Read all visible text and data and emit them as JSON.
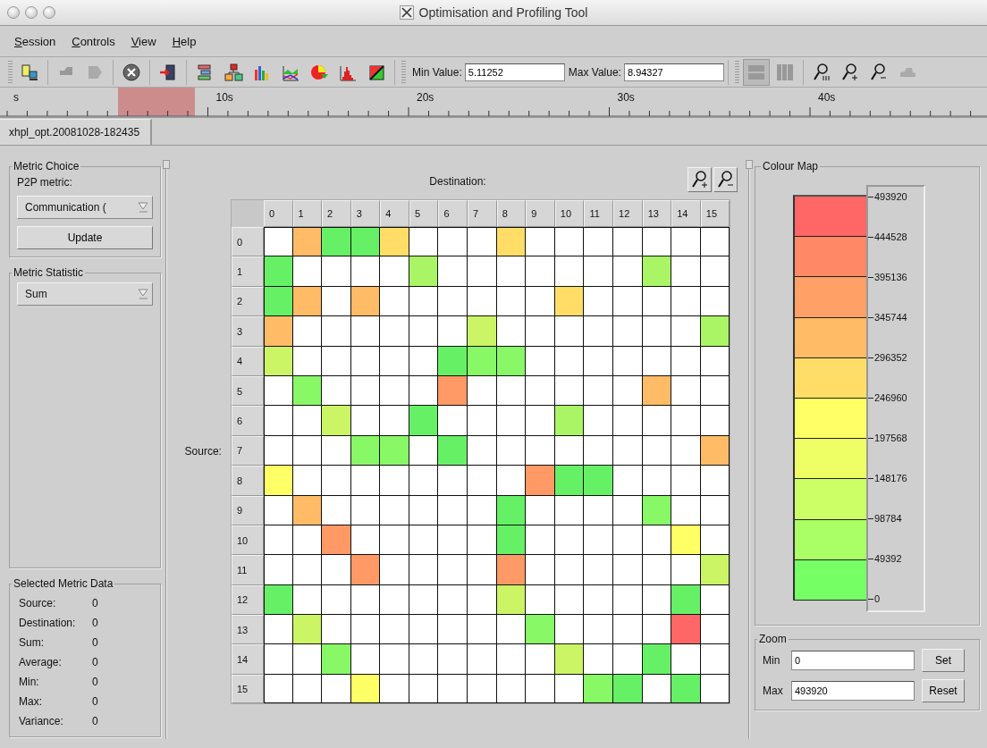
{
  "window": {
    "title": "Optimisation and Profiling Tool"
  },
  "menu": [
    {
      "label": "Session"
    },
    {
      "label": "Controls"
    },
    {
      "label": "View"
    },
    {
      "label": "Help"
    }
  ],
  "toolbar": {
    "min_label": "Min Value:",
    "min_value": "5.11252",
    "max_label": "Max Value:",
    "max_value": "8.94327"
  },
  "timeline": {
    "labels": [
      "s",
      "10s",
      "20s",
      "30s",
      "40s"
    ]
  },
  "tabs": [
    {
      "label": "xhpl_opt.20081028-182435",
      "selected": true
    }
  ],
  "metric_choice": {
    "title": "Metric Choice",
    "label": "P2P metric:",
    "value": "Communication (",
    "button": "Update"
  },
  "metric_statistic": {
    "title": "Metric Statistic",
    "value": "Sum"
  },
  "selected_metric_data": {
    "title": "Selected Metric Data",
    "rows": [
      {
        "label": "Source:",
        "value": "0"
      },
      {
        "label": "Destination:",
        "value": "0"
      },
      {
        "label": "Sum:",
        "value": "0"
      },
      {
        "label": "Average:",
        "value": "0"
      },
      {
        "label": "Min:",
        "value": "0"
      },
      {
        "label": "Max:",
        "value": "0"
      },
      {
        "label": "Variance:",
        "value": "0"
      }
    ]
  },
  "matrix": {
    "x_title": "Destination:",
    "y_title": "Source:",
    "columns": [
      "0",
      "1",
      "2",
      "3",
      "4",
      "5",
      "6",
      "7",
      "8",
      "9",
      "10",
      "11",
      "12",
      "13",
      "14",
      "15"
    ],
    "rows": [
      {
        "label": "0",
        "cells": [
          {
            "color": "#ffffff"
          },
          {
            "color": "#ffbb66"
          },
          {
            "color": "#66f066"
          },
          {
            "color": "#66f066"
          },
          {
            "color": "#ffdd66"
          },
          {
            "color": "#ffffff"
          },
          {
            "color": "#ffffff"
          },
          {
            "color": "#ffffff"
          },
          {
            "color": "#ffdd66"
          },
          {
            "color": "#ffffff"
          },
          {
            "color": "#ffffff"
          },
          {
            "color": "#ffffff"
          },
          {
            "color": "#ffffff"
          },
          {
            "color": "#ffffff"
          },
          {
            "color": "#ffffff"
          },
          {
            "color": "#ffffff"
          }
        ]
      },
      {
        "label": "1",
        "cells": [
          {
            "color": "#66f066"
          },
          {
            "color": "#ffffff"
          },
          {
            "color": "#ffffff"
          },
          {
            "color": "#ffffff"
          },
          {
            "color": "#ffffff"
          },
          {
            "color": "#aaf566"
          },
          {
            "color": "#ffffff"
          },
          {
            "color": "#ffffff"
          },
          {
            "color": "#ffffff"
          },
          {
            "color": "#ffffff"
          },
          {
            "color": "#ffffff"
          },
          {
            "color": "#ffffff"
          },
          {
            "color": "#ffffff"
          },
          {
            "color": "#aaf566"
          },
          {
            "color": "#ffffff"
          },
          {
            "color": "#ffffff"
          }
        ]
      },
      {
        "label": "2",
        "cells": [
          {
            "color": "#66f066"
          },
          {
            "color": "#ffbb66"
          },
          {
            "color": "#ffffff"
          },
          {
            "color": "#ffbb66"
          },
          {
            "color": "#ffffff"
          },
          {
            "color": "#ffffff"
          },
          {
            "color": "#ffffff"
          },
          {
            "color": "#ffffff"
          },
          {
            "color": "#ffffff"
          },
          {
            "color": "#ffffff"
          },
          {
            "color": "#ffdd66"
          },
          {
            "color": "#ffffff"
          },
          {
            "color": "#ffffff"
          },
          {
            "color": "#ffffff"
          },
          {
            "color": "#ffffff"
          },
          {
            "color": "#ffffff"
          }
        ]
      },
      {
        "label": "3",
        "cells": [
          {
            "color": "#ffbb66"
          },
          {
            "color": "#ffffff"
          },
          {
            "color": "#ffffff"
          },
          {
            "color": "#ffffff"
          },
          {
            "color": "#ffffff"
          },
          {
            "color": "#ffffff"
          },
          {
            "color": "#ffffff"
          },
          {
            "color": "#ccf566"
          },
          {
            "color": "#ffffff"
          },
          {
            "color": "#ffffff"
          },
          {
            "color": "#ffffff"
          },
          {
            "color": "#ffffff"
          },
          {
            "color": "#ffffff"
          },
          {
            "color": "#ffffff"
          },
          {
            "color": "#ffffff"
          },
          {
            "color": "#aaf566"
          }
        ]
      },
      {
        "label": "4",
        "cells": [
          {
            "color": "#ccf566"
          },
          {
            "color": "#ffffff"
          },
          {
            "color": "#ffffff"
          },
          {
            "color": "#ffffff"
          },
          {
            "color": "#ffffff"
          },
          {
            "color": "#ffffff"
          },
          {
            "color": "#66f066"
          },
          {
            "color": "#88f866"
          },
          {
            "color": "#88f866"
          },
          {
            "color": "#ffffff"
          },
          {
            "color": "#ffffff"
          },
          {
            "color": "#ffffff"
          },
          {
            "color": "#ffffff"
          },
          {
            "color": "#ffffff"
          },
          {
            "color": "#ffffff"
          },
          {
            "color": "#ffffff"
          }
        ]
      },
      {
        "label": "5",
        "cells": [
          {
            "color": "#ffffff"
          },
          {
            "color": "#88f866"
          },
          {
            "color": "#ffffff"
          },
          {
            "color": "#ffffff"
          },
          {
            "color": "#ffffff"
          },
          {
            "color": "#ffffff"
          },
          {
            "color": "#ff9966"
          },
          {
            "color": "#ffffff"
          },
          {
            "color": "#ffffff"
          },
          {
            "color": "#ffffff"
          },
          {
            "color": "#ffffff"
          },
          {
            "color": "#ffffff"
          },
          {
            "color": "#ffffff"
          },
          {
            "color": "#ffbb66"
          },
          {
            "color": "#ffffff"
          },
          {
            "color": "#ffffff"
          }
        ]
      },
      {
        "label": "6",
        "cells": [
          {
            "color": "#ffffff"
          },
          {
            "color": "#ffffff"
          },
          {
            "color": "#ccf566"
          },
          {
            "color": "#ffffff"
          },
          {
            "color": "#ffffff"
          },
          {
            "color": "#66f066"
          },
          {
            "color": "#ffffff"
          },
          {
            "color": "#ffffff"
          },
          {
            "color": "#ffffff"
          },
          {
            "color": "#ffffff"
          },
          {
            "color": "#aaf566"
          },
          {
            "color": "#ffffff"
          },
          {
            "color": "#ffffff"
          },
          {
            "color": "#ffffff"
          },
          {
            "color": "#ffffff"
          },
          {
            "color": "#ffffff"
          }
        ]
      },
      {
        "label": "7",
        "cells": [
          {
            "color": "#ffffff"
          },
          {
            "color": "#ffffff"
          },
          {
            "color": "#ffffff"
          },
          {
            "color": "#88f866"
          },
          {
            "color": "#88f866"
          },
          {
            "color": "#ffffff"
          },
          {
            "color": "#66f066"
          },
          {
            "color": "#ffffff"
          },
          {
            "color": "#ffffff"
          },
          {
            "color": "#ffffff"
          },
          {
            "color": "#ffffff"
          },
          {
            "color": "#ffffff"
          },
          {
            "color": "#ffffff"
          },
          {
            "color": "#ffffff"
          },
          {
            "color": "#ffffff"
          },
          {
            "color": "#ffbb66"
          }
        ]
      },
      {
        "label": "8",
        "cells": [
          {
            "color": "#ffff66"
          },
          {
            "color": "#ffffff"
          },
          {
            "color": "#ffffff"
          },
          {
            "color": "#ffffff"
          },
          {
            "color": "#ffffff"
          },
          {
            "color": "#ffffff"
          },
          {
            "color": "#ffffff"
          },
          {
            "color": "#ffffff"
          },
          {
            "color": "#ffffff"
          },
          {
            "color": "#ff9966"
          },
          {
            "color": "#66f066"
          },
          {
            "color": "#66f066"
          },
          {
            "color": "#ffffff"
          },
          {
            "color": "#ffffff"
          },
          {
            "color": "#ffffff"
          },
          {
            "color": "#ffffff"
          }
        ]
      },
      {
        "label": "9",
        "cells": [
          {
            "color": "#ffffff"
          },
          {
            "color": "#ffbb66"
          },
          {
            "color": "#ffffff"
          },
          {
            "color": "#ffffff"
          },
          {
            "color": "#ffffff"
          },
          {
            "color": "#ffffff"
          },
          {
            "color": "#ffffff"
          },
          {
            "color": "#ffffff"
          },
          {
            "color": "#66f066"
          },
          {
            "color": "#ffffff"
          },
          {
            "color": "#ffffff"
          },
          {
            "color": "#ffffff"
          },
          {
            "color": "#ffffff"
          },
          {
            "color": "#88f866"
          },
          {
            "color": "#ffffff"
          },
          {
            "color": "#ffffff"
          }
        ]
      },
      {
        "label": "10",
        "cells": [
          {
            "color": "#ffffff"
          },
          {
            "color": "#ffffff"
          },
          {
            "color": "#ff9966"
          },
          {
            "color": "#ffffff"
          },
          {
            "color": "#ffffff"
          },
          {
            "color": "#ffffff"
          },
          {
            "color": "#ffffff"
          },
          {
            "color": "#ffffff"
          },
          {
            "color": "#66f066"
          },
          {
            "color": "#ffffff"
          },
          {
            "color": "#ffffff"
          },
          {
            "color": "#ffffff"
          },
          {
            "color": "#ffffff"
          },
          {
            "color": "#ffffff"
          },
          {
            "color": "#ffff66"
          },
          {
            "color": "#ffffff"
          }
        ]
      },
      {
        "label": "11",
        "cells": [
          {
            "color": "#ffffff"
          },
          {
            "color": "#ffffff"
          },
          {
            "color": "#ffffff"
          },
          {
            "color": "#ff9966"
          },
          {
            "color": "#ffffff"
          },
          {
            "color": "#ffffff"
          },
          {
            "color": "#ffffff"
          },
          {
            "color": "#ffffff"
          },
          {
            "color": "#ff9966"
          },
          {
            "color": "#ffffff"
          },
          {
            "color": "#ffffff"
          },
          {
            "color": "#ffffff"
          },
          {
            "color": "#ffffff"
          },
          {
            "color": "#ffffff"
          },
          {
            "color": "#ffffff"
          },
          {
            "color": "#ccf566"
          }
        ]
      },
      {
        "label": "12",
        "cells": [
          {
            "color": "#66f066"
          },
          {
            "color": "#ffffff"
          },
          {
            "color": "#ffffff"
          },
          {
            "color": "#ffffff"
          },
          {
            "color": "#ffffff"
          },
          {
            "color": "#ffffff"
          },
          {
            "color": "#ffffff"
          },
          {
            "color": "#ffffff"
          },
          {
            "color": "#ccf566"
          },
          {
            "color": "#ffffff"
          },
          {
            "color": "#ffffff"
          },
          {
            "color": "#ffffff"
          },
          {
            "color": "#ffffff"
          },
          {
            "color": "#ffffff"
          },
          {
            "color": "#66f066"
          },
          {
            "color": "#ffffff"
          }
        ]
      },
      {
        "label": "13",
        "cells": [
          {
            "color": "#ffffff"
          },
          {
            "color": "#ccf566"
          },
          {
            "color": "#ffffff"
          },
          {
            "color": "#ffffff"
          },
          {
            "color": "#ffffff"
          },
          {
            "color": "#ffffff"
          },
          {
            "color": "#ffffff"
          },
          {
            "color": "#ffffff"
          },
          {
            "color": "#ffffff"
          },
          {
            "color": "#88f866"
          },
          {
            "color": "#ffffff"
          },
          {
            "color": "#ffffff"
          },
          {
            "color": "#ffffff"
          },
          {
            "color": "#ffffff"
          },
          {
            "color": "#ff6666"
          },
          {
            "color": "#ffffff"
          }
        ]
      },
      {
        "label": "14",
        "cells": [
          {
            "color": "#ffffff"
          },
          {
            "color": "#ffffff"
          },
          {
            "color": "#88f866"
          },
          {
            "color": "#ffffff"
          },
          {
            "color": "#ffffff"
          },
          {
            "color": "#ffffff"
          },
          {
            "color": "#ffffff"
          },
          {
            "color": "#ffffff"
          },
          {
            "color": "#ffffff"
          },
          {
            "color": "#ffffff"
          },
          {
            "color": "#ccf566"
          },
          {
            "color": "#ffffff"
          },
          {
            "color": "#ffffff"
          },
          {
            "color": "#66f066"
          },
          {
            "color": "#ffffff"
          },
          {
            "color": "#ffffff"
          }
        ]
      },
      {
        "label": "15",
        "cells": [
          {
            "color": "#ffffff"
          },
          {
            "color": "#ffffff"
          },
          {
            "color": "#ffffff"
          },
          {
            "color": "#ffff66"
          },
          {
            "color": "#ffffff"
          },
          {
            "color": "#ffffff"
          },
          {
            "color": "#ffffff"
          },
          {
            "color": "#ffffff"
          },
          {
            "color": "#ffffff"
          },
          {
            "color": "#ffffff"
          },
          {
            "color": "#ffffff"
          },
          {
            "color": "#88f866"
          },
          {
            "color": "#66f066"
          },
          {
            "color": "#ffffff"
          },
          {
            "color": "#66f066"
          },
          {
            "color": "#ffffff"
          }
        ]
      }
    ]
  },
  "colour_map": {
    "title": "Colour Map",
    "bands": [
      {
        "color": "#ff6666"
      },
      {
        "color": "#ff8866"
      },
      {
        "color": "#ffa066"
      },
      {
        "color": "#ffbb66"
      },
      {
        "color": "#ffdd66"
      },
      {
        "color": "#ffff66"
      },
      {
        "color": "#eeff66"
      },
      {
        "color": "#ccff66"
      },
      {
        "color": "#aaff66"
      },
      {
        "color": "#77ff66"
      }
    ],
    "ticks": [
      "493920",
      "444528",
      "395136",
      "345744",
      "296352",
      "246960",
      "197568",
      "148176",
      "98784",
      "49392",
      "0"
    ]
  },
  "zoom": {
    "title": "Zoom",
    "min_label": "Min",
    "min_value": "0",
    "set_button": "Set",
    "max_label": "Max",
    "max_value": "493920",
    "reset_button": "Reset"
  }
}
